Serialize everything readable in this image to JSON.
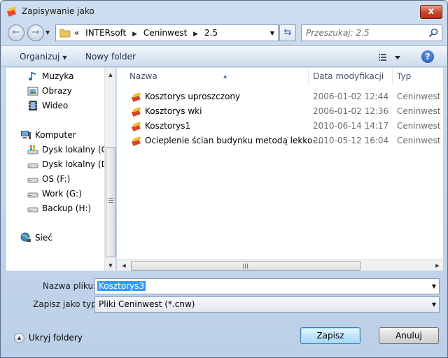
{
  "window": {
    "title": "Zapisywanie jako",
    "close_label": "x"
  },
  "nav": {
    "breadcrumbs": [
      "«",
      "INTERsoft",
      "Ceninwest",
      "2.5"
    ],
    "search_placeholder": "Przeszukaj: 2.5"
  },
  "toolbar": {
    "organize_label": "Organizuj",
    "new_folder_label": "Nowy folder",
    "help_label": "?"
  },
  "sidebar": {
    "items": [
      {
        "label": "Muzyka",
        "icon": "music-icon"
      },
      {
        "label": "Obrazy",
        "icon": "pictures-icon"
      },
      {
        "label": "Wideo",
        "icon": "video-icon"
      },
      {
        "label": "Komputer",
        "icon": "computer-icon"
      },
      {
        "label": "Dysk lokalny (C:)",
        "icon": "system-drive-icon"
      },
      {
        "label": "Dysk lokalny (D:)",
        "icon": "drive-icon"
      },
      {
        "label": "OS (F:)",
        "icon": "drive-icon"
      },
      {
        "label": "Work (G:)",
        "icon": "drive-icon"
      },
      {
        "label": "Backup (H:)",
        "icon": "drive-icon"
      },
      {
        "label": "Sieć",
        "icon": "network-icon"
      }
    ]
  },
  "filelist": {
    "columns": [
      "Nazwa",
      "Data modyfikacji",
      "Typ"
    ],
    "rows": [
      {
        "name": "Kosztorys uproszczony",
        "date": "2006-01-02 12:44",
        "type": "Ceninwest Fi"
      },
      {
        "name": "Kosztorys wki",
        "date": "2006-01-02 12:36",
        "type": "Ceninwest Fi"
      },
      {
        "name": "Kosztorys1",
        "date": "2010-06-14 14:17",
        "type": "Ceninwest Fi"
      },
      {
        "name": "Ocieplenie ścian budynku metodą lekko-...",
        "date": "2010-05-12 16:04",
        "type": "Ceninwest Fi"
      }
    ]
  },
  "form": {
    "filename_label": "Nazwa pliku:",
    "filename_value": "Kosztorys3",
    "type_label": "Zapisz jako typ:",
    "type_value": "Pliki Ceninwest (*.cnw)"
  },
  "footer": {
    "hide_folders_label": "Ukryj foldery",
    "save_label": "Zapisz",
    "cancel_label": "Anuluj"
  },
  "colors": {
    "accent": "#3399ff",
    "chrome": "#cddcee",
    "close": "#c94a30"
  }
}
